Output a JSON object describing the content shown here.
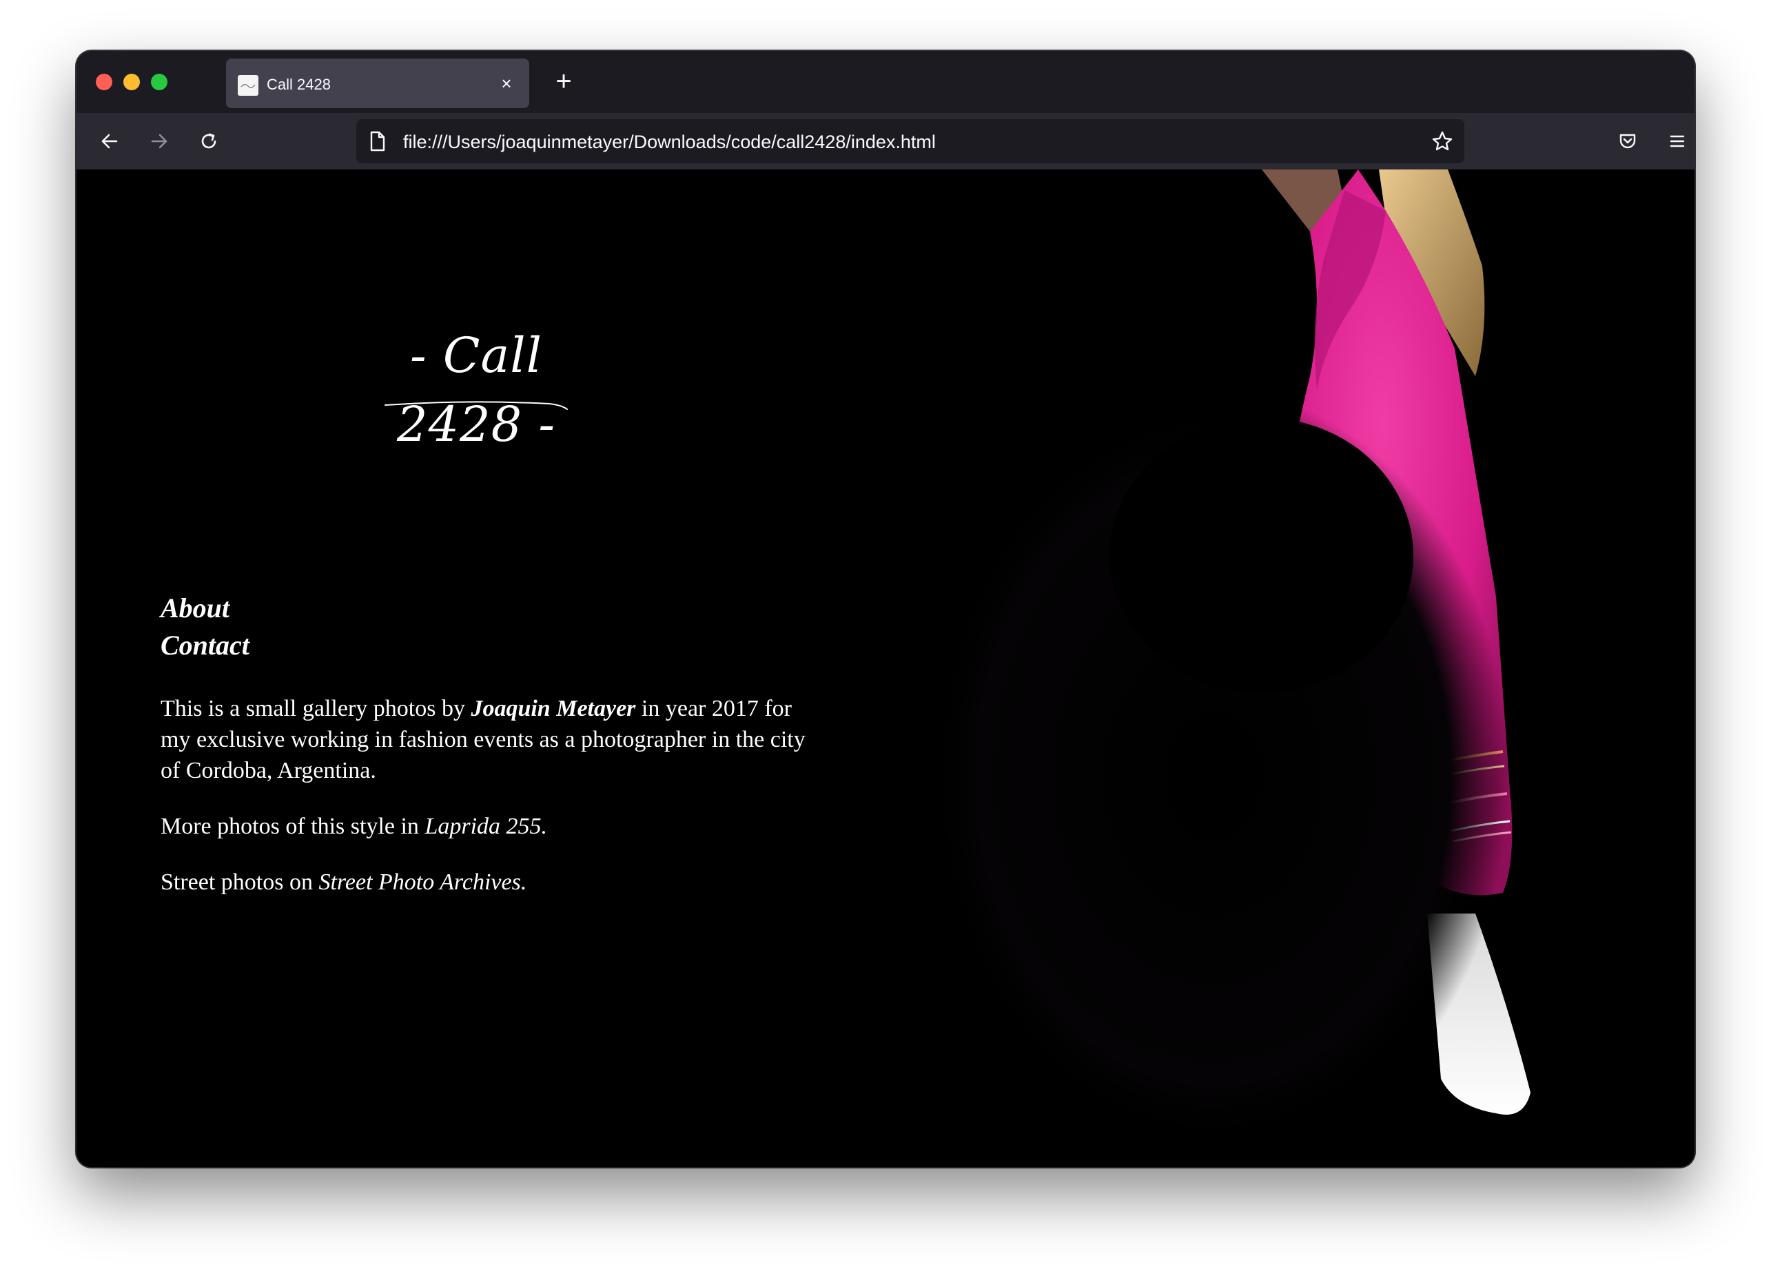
{
  "browser": {
    "tab_title": "Call 2428",
    "tab_close": "×",
    "new_tab": "+",
    "url": "file:///Users/joaquinmetayer/Downloads/code/call2428/index.html"
  },
  "site": {
    "logo": "- Call 2428 -",
    "nav": [
      "About",
      "Contact"
    ],
    "intro_start": "This is a small gallery photos by ",
    "author": "Joaquin Metayer",
    "intro_mid": " in year 2017 for my exclusive working in fashion events as a photographer in the city of Cordoba, Argentina.",
    "more_prefix": "More photos of this style in ",
    "more_link": "Laprida 255.",
    "street_prefix": "Street photos on ",
    "street_link": "Street Photo Archives."
  },
  "colors": {
    "window_bg": "#000000",
    "tabstrip": "#1c1b22",
    "toolbar": "#2b2a33",
    "jacket": "#e0208f"
  },
  "icons": [
    "back-arrow-icon",
    "forward-arrow-icon",
    "reload-icon",
    "page-icon",
    "star-icon",
    "pocket-icon",
    "menu-icon",
    "close-icon",
    "plus-icon"
  ]
}
